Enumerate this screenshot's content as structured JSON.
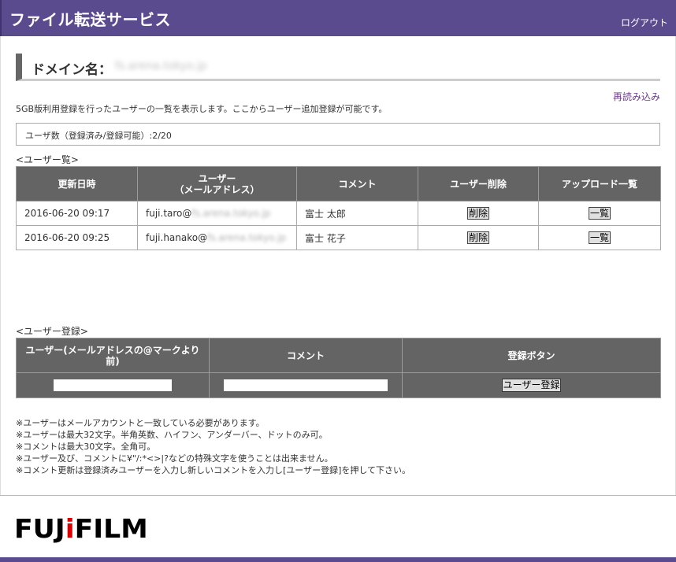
{
  "header": {
    "title": "ファイル転送サービス",
    "logout": "ログアウト"
  },
  "domain": {
    "label": "ドメイン名：",
    "value": "fs.arena.tokyo.jp"
  },
  "reload": "再読み込み",
  "description": "5GB版利用登録を行ったユーザーの一覧を表示します。ここからユーザー追加登録が可能です。",
  "user_count": "ユーザ数（登録済み/登録可能）:2/20",
  "user_list": {
    "section_label": "<ユーザー覧>",
    "headers": {
      "updated": "更新日時",
      "user_line1": "ユーザー",
      "user_line2": "（メールアドレス）",
      "comment": "コメント",
      "delete": "ユーザー削除",
      "uploads": "アップロード一覧"
    },
    "rows": [
      {
        "updated": "2016-06-20 09:17",
        "email_user": "fuji.taro@",
        "email_domain": "fs.arena.tokyo.jp",
        "comment": "富士 太郎",
        "delete_label": "削除",
        "list_label": "一覧"
      },
      {
        "updated": "2016-06-20 09:25",
        "email_user": "fuji.hanako@",
        "email_domain": "fs.arena.tokyo.jp",
        "comment": "富士 花子",
        "delete_label": "削除",
        "list_label": "一覧"
      }
    ]
  },
  "register": {
    "section_label": "<ユーザー登録>",
    "headers": {
      "user_line1": "ユーザー(メールアドレスの@マークより",
      "user_line2": "前)",
      "comment": "コメント",
      "button_col": "登録ボタン"
    },
    "user_input_value": "",
    "comment_input_value": "",
    "button_label": "ユーザー登録"
  },
  "notes": [
    "※ユーザーはメールアカウントと一致している必要があります。",
    "※ユーザーは最大32文字。半角英数、ハイフン、アンダーバー、ドットのみ可。",
    "※コメントは最大30文字。全角可。",
    "※ユーザー及び、コメントに¥\"/:*<>|?などの特殊文字を使うことは出来ません。",
    "※コメント更新は登録済みユーザーを入力し新しいコメントを入力し[ユーザー登録]を押して下さい。"
  ],
  "logo": {
    "text_left": "FUJ",
    "text_dot": "i",
    "text_right": "FILM",
    "text": "FUJIFILM"
  },
  "colors": {
    "header": "#5a4a8e",
    "table_header": "#646464",
    "link": "#6a3a8a"
  }
}
